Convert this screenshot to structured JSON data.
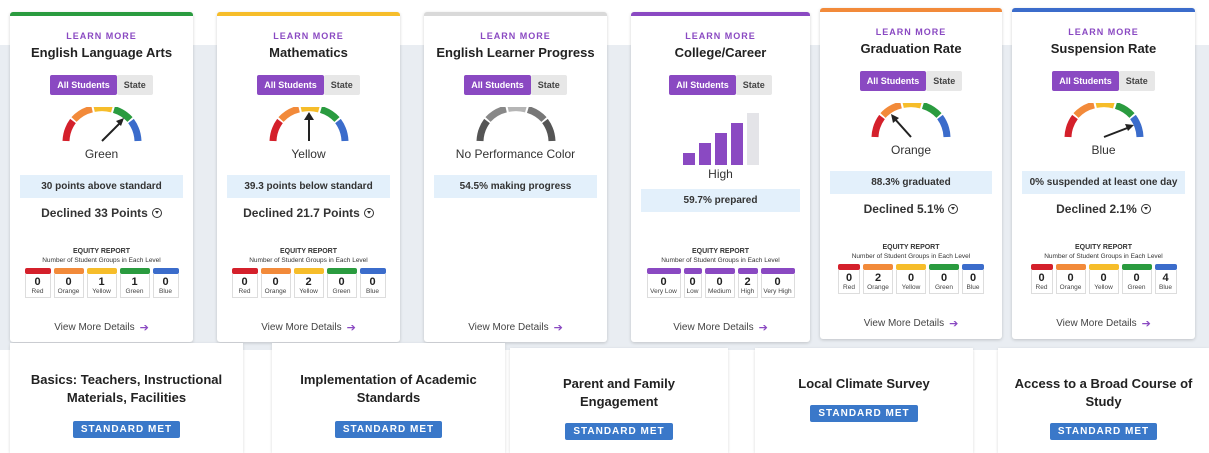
{
  "colors": {
    "accent": "#8a49c2",
    "red": "#d4202b",
    "orange": "#f28a3a",
    "yellow": "#f6bd2a",
    "green": "#2a9b3f",
    "blue": "#3b6ccb",
    "gray": "#9a9a9a",
    "standard_met": "#3a78c9"
  },
  "cards": [
    {
      "learn": "LEARN MORE",
      "title": "English Language Arts",
      "toggle_on": "All Students",
      "toggle_off": "State",
      "color_label": "Green",
      "stat": "30 points above standard",
      "change": "Declined 33 Points",
      "equity_title": "EQUITY REPORT",
      "equity_sub": "Number of Student Groups in Each Level",
      "equity_counts": [
        "0",
        "0",
        "1",
        "1",
        "0"
      ],
      "details": "View More Details"
    },
    {
      "learn": "LEARN MORE",
      "title": "Mathematics",
      "toggle_on": "All Students",
      "toggle_off": "State",
      "color_label": "Yellow",
      "stat": "39.3 points below standard",
      "change": "Declined 21.7 Points",
      "equity_title": "EQUITY REPORT",
      "equity_sub": "Number of Student Groups in Each Level",
      "equity_counts": [
        "0",
        "0",
        "2",
        "0",
        "0"
      ],
      "details": "View More Details"
    },
    {
      "learn": "LEARN MORE",
      "title": "English Learner Progress",
      "toggle_on": "All Students",
      "toggle_off": "State",
      "color_label": "No Performance Color",
      "stat": "54.5% making progress",
      "details": "View More Details"
    },
    {
      "learn": "LEARN MORE",
      "title": "College/Career",
      "toggle_on": "All Students",
      "toggle_off": "State",
      "color_label": "High",
      "stat": "59.7% prepared",
      "equity_title": "EQUITY REPORT",
      "equity_sub": "Number of Student Groups in Each Level",
      "equity_counts": [
        "0",
        "0",
        "0",
        "2",
        "0"
      ],
      "details": "View More Details"
    },
    {
      "learn": "LEARN MORE",
      "title": "Graduation Rate",
      "toggle_on": "All Students",
      "toggle_off": "State",
      "color_label": "Orange",
      "stat": "88.3% graduated",
      "change": "Declined 5.1%",
      "equity_title": "EQUITY REPORT",
      "equity_sub": "Number of Student Groups in Each Level",
      "equity_counts": [
        "0",
        "2",
        "0",
        "0",
        "0"
      ],
      "details": "View More Details"
    },
    {
      "learn": "LEARN MORE",
      "title": "Suspension Rate",
      "toggle_on": "All Students",
      "toggle_off": "State",
      "color_label": "Blue",
      "stat": "0% suspended at least one day",
      "change": "Declined 2.1%",
      "equity_title": "EQUITY REPORT",
      "equity_sub": "Number of Student Groups in Each Level",
      "equity_counts": [
        "0",
        "0",
        "0",
        "0",
        "4"
      ],
      "details": "View More Details"
    }
  ],
  "level_labels": [
    "Red",
    "Orange",
    "Yellow",
    "Green",
    "Blue"
  ],
  "cc_level_labels": [
    "Very Low",
    "Low",
    "Medium",
    "High",
    "Very High"
  ],
  "local": [
    {
      "title": "Basics: Teachers, Instructional Materials, Facilities",
      "status": "STANDARD MET"
    },
    {
      "title": "Implementation of Academic Standards",
      "status": "STANDARD MET"
    },
    {
      "title": "Parent and Family Engagement",
      "status": "STANDARD MET"
    },
    {
      "title": "Local Climate Survey",
      "status": "STANDARD MET"
    },
    {
      "title": "Access to a Broad Course of Study",
      "status": "STANDARD MET"
    }
  ]
}
